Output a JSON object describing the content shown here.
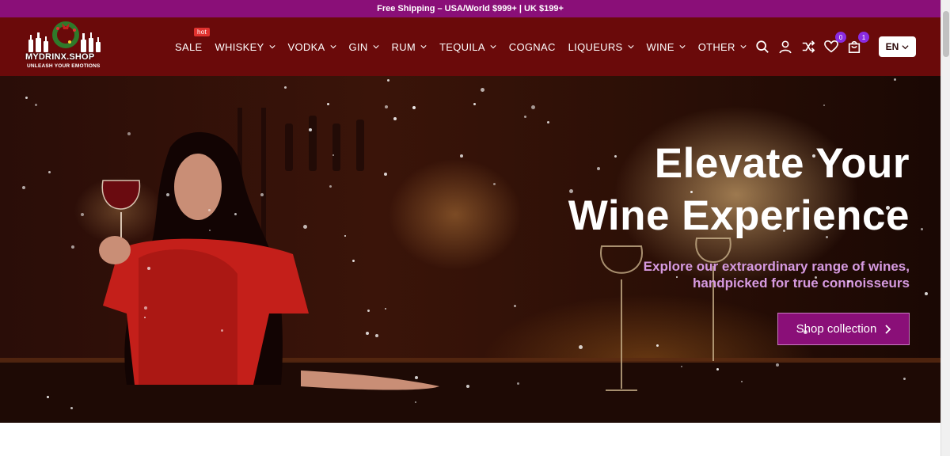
{
  "announcement": "Free Shipping – USA/World $999+ | UK $199+",
  "logo": {
    "name": "MYDRINX.SHOP",
    "tagline": "UNLEASH YOUR EMOTIONS"
  },
  "nav": {
    "items": [
      {
        "label": "SALE",
        "badge": "hot",
        "has_dropdown": false
      },
      {
        "label": "WHISKEY",
        "has_dropdown": true
      },
      {
        "label": "VODKA",
        "has_dropdown": true
      },
      {
        "label": "GIN",
        "has_dropdown": true
      },
      {
        "label": "RUM",
        "has_dropdown": true
      },
      {
        "label": "TEQUILA",
        "has_dropdown": true
      },
      {
        "label": "COGNAC",
        "has_dropdown": false
      },
      {
        "label": "LIQUEURS",
        "has_dropdown": true
      },
      {
        "label": "WINE",
        "has_dropdown": true
      },
      {
        "label": "OTHER",
        "has_dropdown": true
      }
    ]
  },
  "header_icons": {
    "search": "search-icon",
    "account": "user-icon",
    "compare": "shuffle-icon",
    "wishlist": {
      "icon": "heart-icon",
      "count": "0"
    },
    "cart": {
      "icon": "bag-icon",
      "count": "1"
    }
  },
  "language": {
    "selected": "EN"
  },
  "hero": {
    "title_line1": "Elevate Your",
    "title_line2": "Wine Experience",
    "subtitle_line1": "Explore our extraordinary range of wines,",
    "subtitle_line2": "handpicked for true connoisseurs",
    "cta_label": "Shop collection"
  },
  "colors": {
    "announcement_bg": "#8a0f78",
    "header_bg": "#6a0a0a",
    "accent": "#8a0f78",
    "subtitle": "#d69ae0",
    "badge_hot": "#e0322f",
    "count_badge": "#8a2be2"
  }
}
